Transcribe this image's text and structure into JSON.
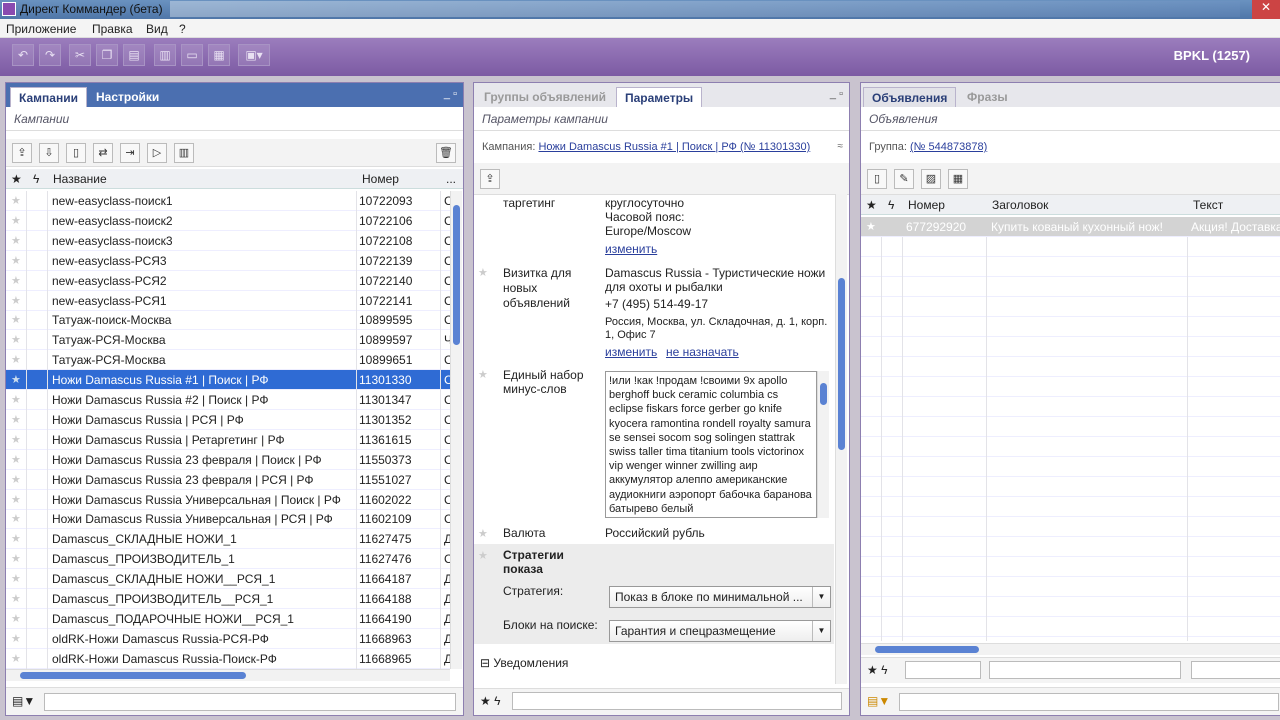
{
  "window": {
    "title": "Директ Коммандер (бета)"
  },
  "menu": [
    "Приложение",
    "Правка",
    "Вид",
    "?"
  ],
  "toolbar": {
    "brand": "BPKL (1257)"
  },
  "left": {
    "tabs": [
      "Кампании",
      "Настройки"
    ],
    "subtitle": "Кампании",
    "cols": {
      "star": "★",
      "bolt": "ϟ",
      "name": "Название",
      "num": "Номер",
      "more": "..."
    },
    "rows": [
      {
        "name": "new-easyclass-поиск1",
        "num": "10722093",
        "x": "С"
      },
      {
        "name": "new-easyclass-поиск2",
        "num": "10722106",
        "x": "С"
      },
      {
        "name": "new-easyclass-поиск3",
        "num": "10722108",
        "x": "С"
      },
      {
        "name": "new-easyclass-РСЯ3",
        "num": "10722139",
        "x": "С"
      },
      {
        "name": "new-easyclass-РСЯ2",
        "num": "10722140",
        "x": "С"
      },
      {
        "name": "new-easyclass-РСЯ1",
        "num": "10722141",
        "x": "С"
      },
      {
        "name": "Татуаж-поиск-Москва",
        "num": "10899595",
        "x": "С"
      },
      {
        "name": "Татуаж-РСЯ-Москва",
        "num": "10899597",
        "x": "Ч"
      },
      {
        "name": "Татуаж-РСЯ-Москва",
        "num": "10899651",
        "x": "С"
      },
      {
        "name": "Ножи Damascus Russia #1 | Поиск | РФ",
        "num": "11301330",
        "x": "С"
      },
      {
        "name": "Ножи Damascus Russia #2 | Поиск | РФ",
        "num": "11301347",
        "x": "С"
      },
      {
        "name": "Ножи Damascus Russia | РСЯ | РФ",
        "num": "11301352",
        "x": "С"
      },
      {
        "name": "Ножи Damascus Russia | Ретаргетинг | РФ",
        "num": "11361615",
        "x": "С"
      },
      {
        "name": "Ножи Damascus Russia 23 февраля | Поиск | РФ",
        "num": "11550373",
        "x": "С"
      },
      {
        "name": "Ножи Damascus Russia 23 февраля | РСЯ | РФ",
        "num": "11551027",
        "x": "С"
      },
      {
        "name": "Ножи Damascus Russia Универсальная | Поиск | РФ",
        "num": "11602022",
        "x": "С"
      },
      {
        "name": "Ножи Damascus Russia Универсальная | РСЯ | РФ",
        "num": "11602109",
        "x": "С"
      },
      {
        "name": "Damascus_СКЛАДНЫЕ НОЖИ_1",
        "num": "11627475",
        "x": "Д"
      },
      {
        "name": "Damascus_ПРОИЗВОДИТЕЛЬ_1",
        "num": "11627476",
        "x": "С"
      },
      {
        "name": "Damascus_СКЛАДНЫЕ НОЖИ__РСЯ_1",
        "num": "11664187",
        "x": "Д"
      },
      {
        "name": "Damascus_ПРОИЗВОДИТЕЛЬ__РСЯ_1",
        "num": "11664188",
        "x": "Д"
      },
      {
        "name": "Damascus_ПОДАРОЧНЫЕ НОЖИ__РСЯ_1",
        "num": "11664190",
        "x": "Д"
      },
      {
        "name": "oldRK-Ножи Damascus Russia-РСЯ-РФ",
        "num": "11668963",
        "x": "Д"
      },
      {
        "name": "oldRK-Ножи Damascus Russia-Поиск-РФ",
        "num": "11668965",
        "x": "Д"
      }
    ]
  },
  "middle": {
    "tabs": [
      "Группы объявлений",
      "Параметры"
    ],
    "subtitle": "Параметры кампании",
    "campaign_label": "Кампания:",
    "campaign_link": "Ножи Damascus Russia #1 | Поиск | РФ (№ 11301330)",
    "targeting_label": "таргетинг",
    "targeting_lines": [
      "круглосуточно",
      "Часовой пояс:",
      "Europe/Moscow"
    ],
    "change": "изменить",
    "vcard_label": "Визитка для новых объявлений",
    "vcard_title": "Damascus Russia - Туристические ножи для охоты и рыбалки",
    "vcard_phone": "+7 (495) 514-49-17",
    "vcard_address": "Россия, Москва, ул. Складочная, д. 1, корп. 1, Офис 7",
    "unassign": "не назначать",
    "minus_label": "Единый набор минус-слов",
    "minus_words": "!или !как !продам !своими 9х apollo berghoff buck ceramic columbia cs eclipse fiskars force gerber go knife kyocera ramontina rondell royalty samura se sensei socom sog solingen stattrak swiss taller tima titanium tools victorinox vip wenger winner zwilling аир аккумулятор алеппо американские аудиокниги аэропорт бабочка баранова батырево белый",
    "currency_label": "Валюта",
    "currency_value": "Российский рубль",
    "strategy_head": "Стратегии показа",
    "strategy_label": "Стратегия:",
    "strategy_value": "Показ в блоке по минимальной ...",
    "blocks_label": "Блоки на поиске:",
    "blocks_value": "Гарантия и спецразмещение",
    "notifications": "Уведомления"
  },
  "right": {
    "tabs": [
      "Объявления",
      "Фразы"
    ],
    "subtitle": "Объявления",
    "group_label": "Группа:",
    "group_link": "(№ 544873878)",
    "cols": {
      "num": "Номер",
      "title": "Заголовок",
      "text": "Текст"
    },
    "rows": [
      {
        "num": "677292920",
        "title": "Купить кованый кухонный нож!",
        "text": "Акция! Доставка"
      }
    ]
  }
}
